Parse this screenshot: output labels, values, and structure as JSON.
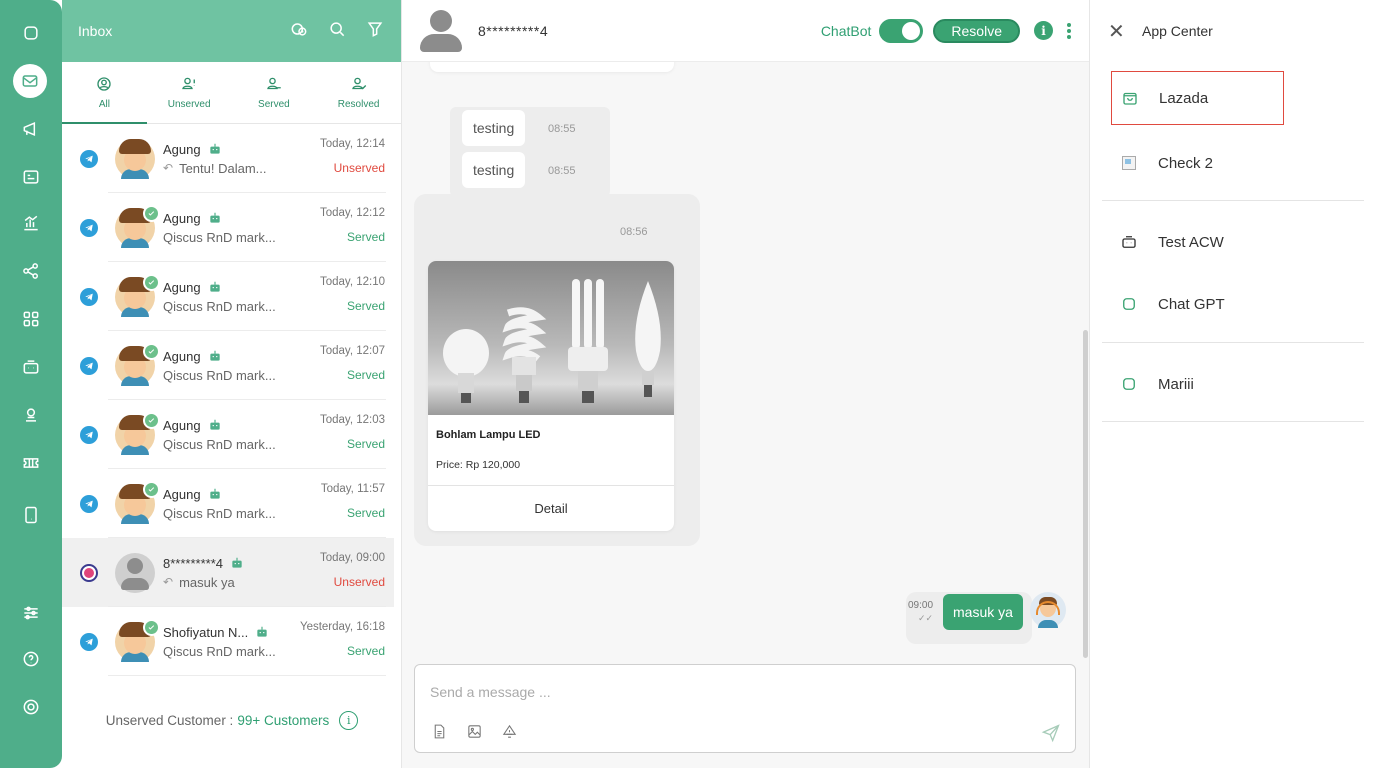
{
  "rail": {
    "icons": [
      "chat-bubble-icon",
      "inbox-icon",
      "broadcast-icon",
      "contacts-icon",
      "analytics-icon",
      "integration-icon",
      "apps-grid-icon",
      "robot-icon",
      "agent-icon",
      "ticket-icon",
      "mobile-icon",
      "settings-sliders-icon",
      "help-icon",
      "power-icon"
    ]
  },
  "inbox": {
    "title": "Inbox",
    "tabs": [
      {
        "label": "All",
        "active": true
      },
      {
        "label": "Unserved"
      },
      {
        "label": "Served"
      },
      {
        "label": "Resolved"
      }
    ],
    "conversations": [
      {
        "name": "Agung",
        "preview": "Tentu! Dalam...",
        "time": "Today, 12:14",
        "status": "Unserved",
        "channel": "telegram",
        "reply": true,
        "served": false
      },
      {
        "name": "Agung",
        "preview": "Qiscus RnD mark...",
        "time": "Today, 12:12",
        "status": "Served",
        "channel": "telegram",
        "served": true
      },
      {
        "name": "Agung",
        "preview": "Qiscus RnD mark...",
        "time": "Today, 12:10",
        "status": "Served",
        "channel": "telegram",
        "served": true
      },
      {
        "name": "Agung",
        "preview": "Qiscus RnD mark...",
        "time": "Today, 12:07",
        "status": "Served",
        "channel": "telegram",
        "served": true
      },
      {
        "name": "Agung",
        "preview": "Qiscus RnD mark...",
        "time": "Today, 12:03",
        "status": "Served",
        "channel": "telegram",
        "served": true
      },
      {
        "name": "Agung",
        "preview": "Qiscus RnD mark...",
        "time": "Today, 11:57",
        "status": "Served",
        "channel": "telegram",
        "served": true
      },
      {
        "name": "8*********4",
        "preview": "masuk ya",
        "time": "Today, 09:00",
        "status": "Unserved",
        "channel": "live-chat",
        "reply": true,
        "served": false,
        "selected": true,
        "guest": true
      },
      {
        "name": "Shofiyatun N...",
        "preview": "Qiscus RnD mark...",
        "time": "Yesterday, 16:18",
        "status": "Served",
        "channel": "telegram",
        "served": true
      }
    ],
    "footer": {
      "label": "Unserved Customer :",
      "count": "99+ Customers",
      "info": "i"
    }
  },
  "chat": {
    "customer_name": "8*********4",
    "chatbot_label": "ChatBot",
    "chatbot_on": true,
    "resolve_label": "Resolve",
    "info_label": "i",
    "messages": [
      {
        "text": "testing",
        "time": "08:55"
      },
      {
        "text": "testing",
        "time": "08:55"
      }
    ],
    "card": {
      "time": "08:56",
      "title": "Bohlam Lampu LED",
      "price": "Price: Rp 120,000",
      "button": "Detail"
    },
    "outgoing": {
      "text": "masuk ya",
      "time": "09:00",
      "ticks": "✓✓"
    },
    "composer": {
      "placeholder": "Send a message ..."
    }
  },
  "app_center": {
    "title": "App Center",
    "close": "✕",
    "items": [
      {
        "label": "Lazada",
        "icon": "shopping-bag-icon"
      },
      {
        "label": "Check 2",
        "icon": "broken-image-icon"
      },
      {
        "label": "Test ACW",
        "icon": "robot-icon"
      },
      {
        "label": "Chat GPT",
        "icon": "chat-bubble-icon"
      },
      {
        "label": "Mariii",
        "icon": "chat-bubble-icon"
      }
    ]
  },
  "colors": {
    "primary": "#4fae8a",
    "unserved": "#e04a3f",
    "served": "#3aa372",
    "highlight_border": "#e04a3f"
  }
}
